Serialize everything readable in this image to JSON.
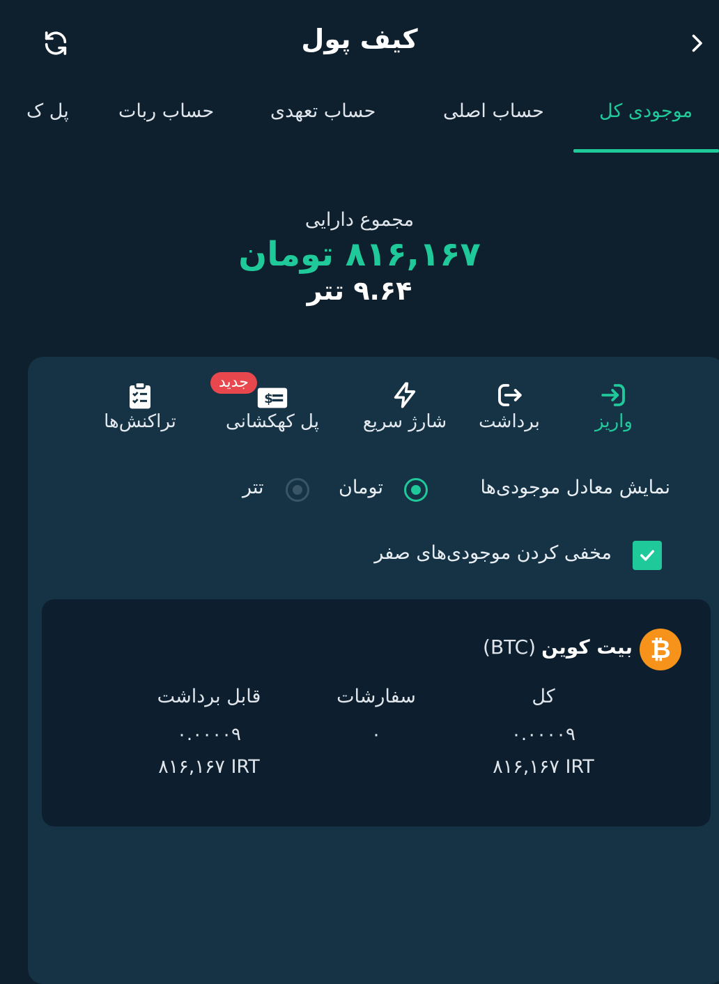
{
  "header": {
    "title": "کیف پول",
    "refresh_icon": "refresh-icon",
    "back_icon": "chevron-right-icon"
  },
  "tabs": [
    {
      "label": "موجودی کل",
      "active": true
    },
    {
      "label": "حساب اصلی",
      "active": false
    },
    {
      "label": "حساب تعهدی",
      "active": false
    },
    {
      "label": "حساب ربات",
      "active": false
    },
    {
      "label": "پل ک",
      "active": false
    }
  ],
  "summary": {
    "label": "مجموع دارایی",
    "toman": "۸۱۶,۱۶۷ تومان",
    "tether": "۹.۶۴ تتر"
  },
  "actions": [
    {
      "label": "واریز",
      "icon": "deposit-icon",
      "active": true
    },
    {
      "label": "برداشت",
      "icon": "withdraw-icon",
      "active": false
    },
    {
      "label": "شارژ سریع",
      "icon": "lightning-icon",
      "active": false
    },
    {
      "label": "پل کهکشانی",
      "icon": "money-bill-icon",
      "active": false,
      "badge": "جدید"
    },
    {
      "label": "تراکنش‌ها",
      "icon": "clipboard-list-icon",
      "active": false
    }
  ],
  "display": {
    "label": "نمایش معادل موجودی‌ها",
    "options": [
      {
        "label": "تومان",
        "selected": true
      },
      {
        "label": "تتر",
        "selected": false
      }
    ]
  },
  "hide_zero": {
    "label": "مخفی کردن موجودی‌های صفر",
    "checked": true
  },
  "asset": {
    "name": "بیت کوین",
    "symbol": "(BTC)",
    "icon": "bitcoin-icon",
    "columns": [
      {
        "header": "کل",
        "amount": "۰.۰۰۰۰۹",
        "value": "۸۱۶,۱۶۷ IRT"
      },
      {
        "header": "سفارشات",
        "amount": "۰",
        "value": ""
      },
      {
        "header": "قابل برداشت",
        "amount": "۰.۰۰۰۰۹",
        "value": "۸۱۶,۱۶۷ IRT"
      }
    ]
  },
  "colors": {
    "background": "#0e1f2d",
    "panel": "#163346",
    "card": "#0d1f2e",
    "accent": "#20c99a",
    "badge": "#e8484d",
    "bitcoin": "#f7931a"
  }
}
